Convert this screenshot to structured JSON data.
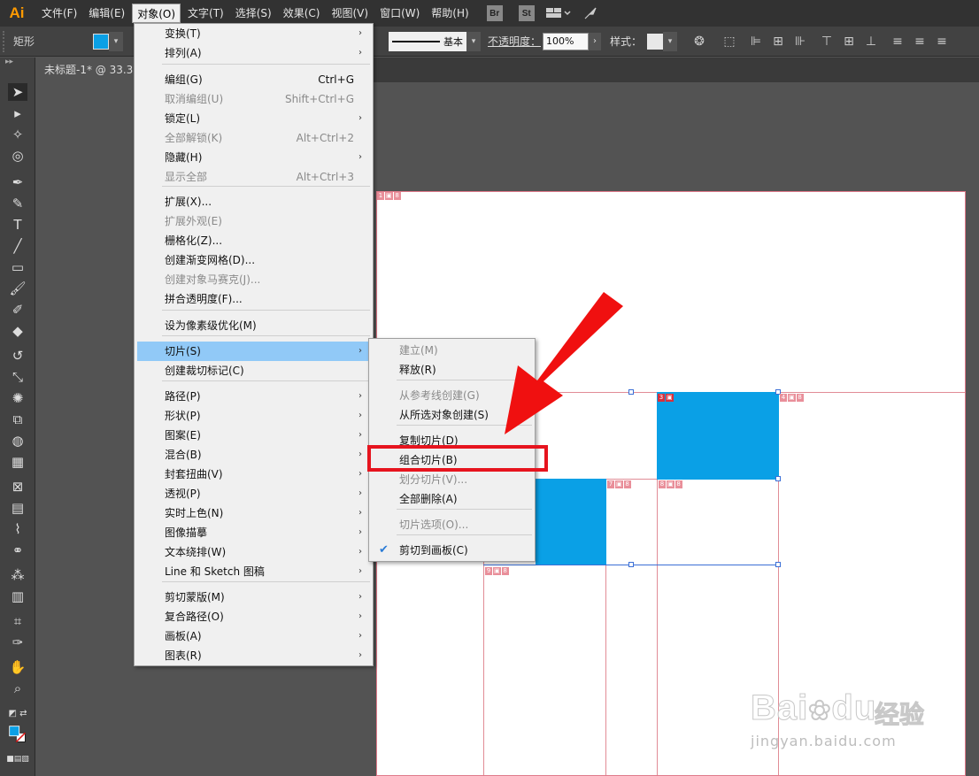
{
  "app": {
    "logo": "Ai"
  },
  "menubar": {
    "items": [
      "文件(F)",
      "编辑(E)",
      "对象(O)",
      "文字(T)",
      "选择(S)",
      "效果(C)",
      "视图(V)",
      "窗口(W)",
      "帮助(H)"
    ],
    "active_index": 2,
    "icons": {
      "bridge": "Br",
      "stock": "St"
    }
  },
  "controlbar": {
    "shape_label": "矩形",
    "fill_color": "#0aa0e6",
    "stroke_label": "基本",
    "opacity_label": "不透明度：",
    "opacity_value": "100%",
    "style_label": "样式："
  },
  "document": {
    "tab_title": "未标题-1* @ 33.3"
  },
  "object_menu": {
    "items": [
      {
        "label": "变换(T)",
        "submenu": true
      },
      {
        "label": "排列(A)",
        "submenu": true
      },
      {
        "label": "编组(G)",
        "shortcut": "Ctrl+G"
      },
      {
        "label": "取消编组(U)",
        "shortcut": "Shift+Ctrl+G",
        "disabled": true
      },
      {
        "label": "锁定(L)",
        "submenu": true
      },
      {
        "label": "全部解锁(K)",
        "shortcut": "Alt+Ctrl+2",
        "disabled": true
      },
      {
        "label": "隐藏(H)",
        "submenu": true
      },
      {
        "label": "显示全部",
        "shortcut": "Alt+Ctrl+3",
        "disabled": true
      },
      {
        "label": "扩展(X)..."
      },
      {
        "label": "扩展外观(E)",
        "disabled": true
      },
      {
        "label": "栅格化(Z)..."
      },
      {
        "label": "创建渐变网格(D)..."
      },
      {
        "label": "创建对象马赛克(J)...",
        "disabled": true
      },
      {
        "label": "拼合透明度(F)..."
      },
      {
        "label": "设为像素级优化(M)"
      },
      {
        "label": "切片(S)",
        "submenu": true,
        "highlighted": true
      },
      {
        "label": "创建裁切标记(C)"
      },
      {
        "label": "路径(P)",
        "submenu": true
      },
      {
        "label": "形状(P)",
        "submenu": true
      },
      {
        "label": "图案(E)",
        "submenu": true
      },
      {
        "label": "混合(B)",
        "submenu": true
      },
      {
        "label": "封套扭曲(V)",
        "submenu": true
      },
      {
        "label": "透视(P)",
        "submenu": true
      },
      {
        "label": "实时上色(N)",
        "submenu": true
      },
      {
        "label": "图像描摹",
        "submenu": true
      },
      {
        "label": "文本绕排(W)",
        "submenu": true
      },
      {
        "label": "Line 和 Sketch 图稿",
        "submenu": true
      },
      {
        "label": "剪切蒙版(M)",
        "submenu": true
      },
      {
        "label": "复合路径(O)",
        "submenu": true
      },
      {
        "label": "画板(A)",
        "submenu": true
      },
      {
        "label": "图表(R)",
        "submenu": true
      }
    ]
  },
  "slice_submenu": {
    "items": [
      {
        "label": "建立(M)",
        "disabled": true
      },
      {
        "label": "释放(R)"
      },
      {
        "label": "从参考线创建(G)",
        "disabled": true
      },
      {
        "label": "从所选对象创建(S)"
      },
      {
        "label": "复制切片(D)"
      },
      {
        "label": "组合切片(B)",
        "boxed": true
      },
      {
        "label": "划分切片(V)...",
        "disabled": true
      },
      {
        "label": "全部删除(A)"
      },
      {
        "label": "切片选项(O)...",
        "disabled": true
      },
      {
        "label": "剪切到画板(C)",
        "checked": true
      }
    ]
  },
  "canvas": {
    "slice_tags": [
      "1",
      "3",
      "4",
      "7",
      "8",
      "9"
    ],
    "rect_color": "#0aa0e6"
  },
  "annotation": {
    "arrow_color": "#e6141e",
    "box_color": "#e6141e"
  },
  "watermark": {
    "brand": "Bai",
    "brand2": "du",
    "cn": "经验",
    "url": "jingyan.baidu.com"
  }
}
